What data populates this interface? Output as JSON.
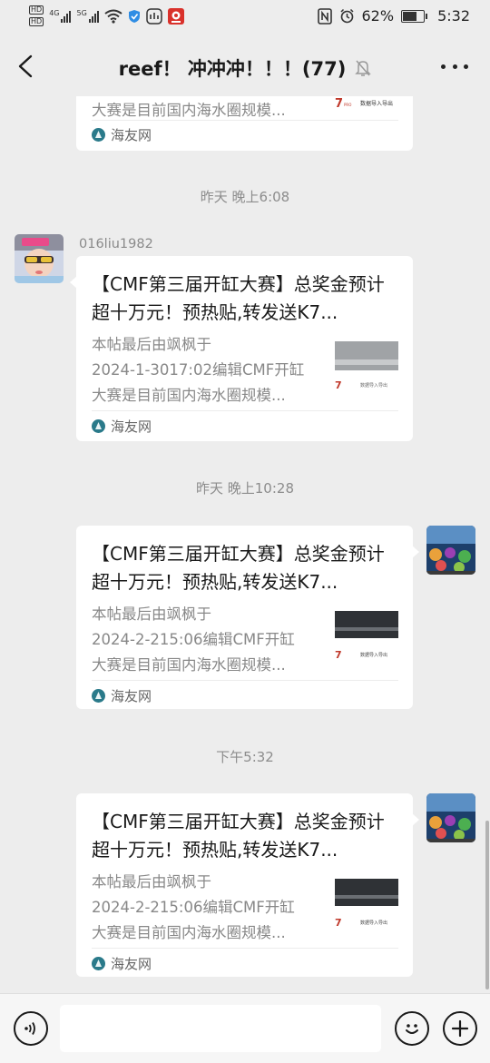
{
  "status_bar": {
    "hd1": "HD",
    "hd2": "HD",
    "net1": "4G",
    "net2": "5G",
    "battery_text": "62%",
    "battery_level": 0.62,
    "time": "5:32"
  },
  "header": {
    "title": "reef！ 冲冲冲！！！(77)",
    "back_icon": "chevron-left-icon",
    "mute_icon": "bell-muted-icon",
    "more_icon": "more-icon"
  },
  "messages": [
    {
      "partial_desc": "大赛是目前国内海水圈规模...",
      "source": "海友网"
    },
    {
      "timestamp": "昨天 晚上6:08",
      "sender": "016liu1982",
      "title": "【CMF第三届开缸大赛】总奖金预计超十万元！预热贴,转发送K7...",
      "desc_lines": [
        "本帖最后由飒枫于",
        "2024-1-3017:02编辑CMF开缸",
        "大赛是目前国内海水圈规模..."
      ],
      "source": "海友网"
    },
    {
      "timestamp": "昨天 晚上10:28",
      "title": "【CMF第三届开缸大赛】总奖金预计超十万元！预热贴,转发送K7...",
      "desc_lines": [
        "本帖最后由飒枫于",
        "2024-2-215:06编辑CMF开缸",
        "大赛是目前国内海水圈规模..."
      ],
      "source": "海友网"
    },
    {
      "timestamp": "下午5:32",
      "title": "【CMF第三届开缸大赛】总奖金预计超十万元！预热贴,转发送K7...",
      "desc_lines": [
        "本帖最后由飒枫于",
        "2024-2-215:06编辑CMF开缸",
        "大赛是目前国内海水圈规模..."
      ],
      "source": "海友网"
    }
  ],
  "thumb_caption": "数据导入导出",
  "input_bar": {
    "voice_icon": "voice-icon",
    "emoji_icon": "emoji-icon",
    "plus_icon": "plus-icon",
    "text_value": ""
  },
  "colors": {
    "background": "#ededed",
    "card": "#ffffff",
    "muted_text": "#888888"
  }
}
